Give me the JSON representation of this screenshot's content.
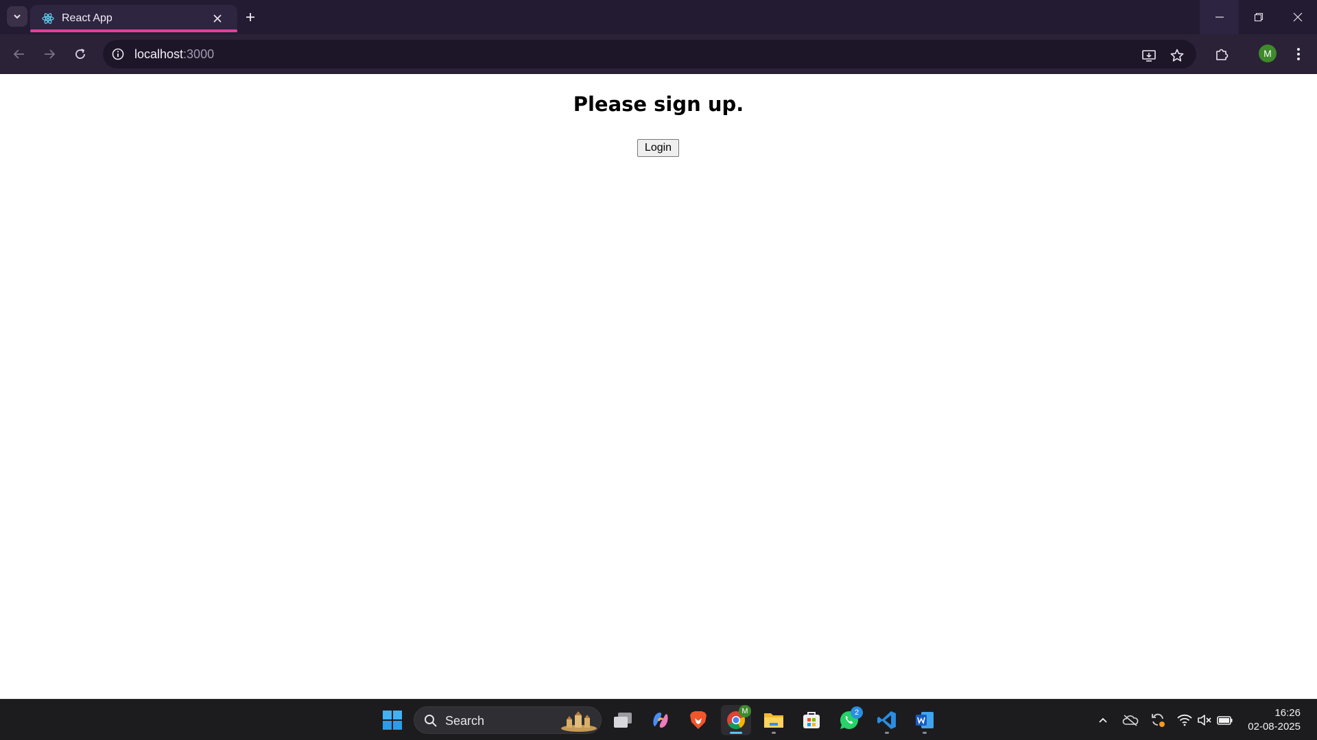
{
  "browser": {
    "tab_title": "React App",
    "url_host": "localhost",
    "url_port": ":3000",
    "profile_initial": "M",
    "accent_color": "#e83e9c",
    "icons": [
      "chevron-down-icon",
      "react-icon",
      "close-icon",
      "plus-icon",
      "back-icon",
      "forward-icon",
      "reload-icon",
      "info-icon",
      "install-app-icon",
      "star-icon",
      "extensions-icon",
      "kebab-menu-icon",
      "minimize-icon",
      "restore-icon",
      "window-close-icon"
    ]
  },
  "page": {
    "heading": "Please sign up.",
    "login_button": "Login"
  },
  "taskbar": {
    "search_label": "Search",
    "whatsapp_badge": "2",
    "chrome_badge": "M",
    "time": "16:26",
    "date": "02-08-2025",
    "apps": [
      "windows-start-icon",
      "task-view-icon",
      "copilot-icon",
      "brave-icon",
      "chrome-icon",
      "file-explorer-icon",
      "microsoft-store-icon",
      "whatsapp-icon",
      "vscode-icon",
      "word-icon"
    ],
    "tray_icons": [
      "chevron-up-icon",
      "onedrive-icon",
      "sync-icon",
      "wifi-icon",
      "volume-muted-icon",
      "battery-icon"
    ]
  }
}
